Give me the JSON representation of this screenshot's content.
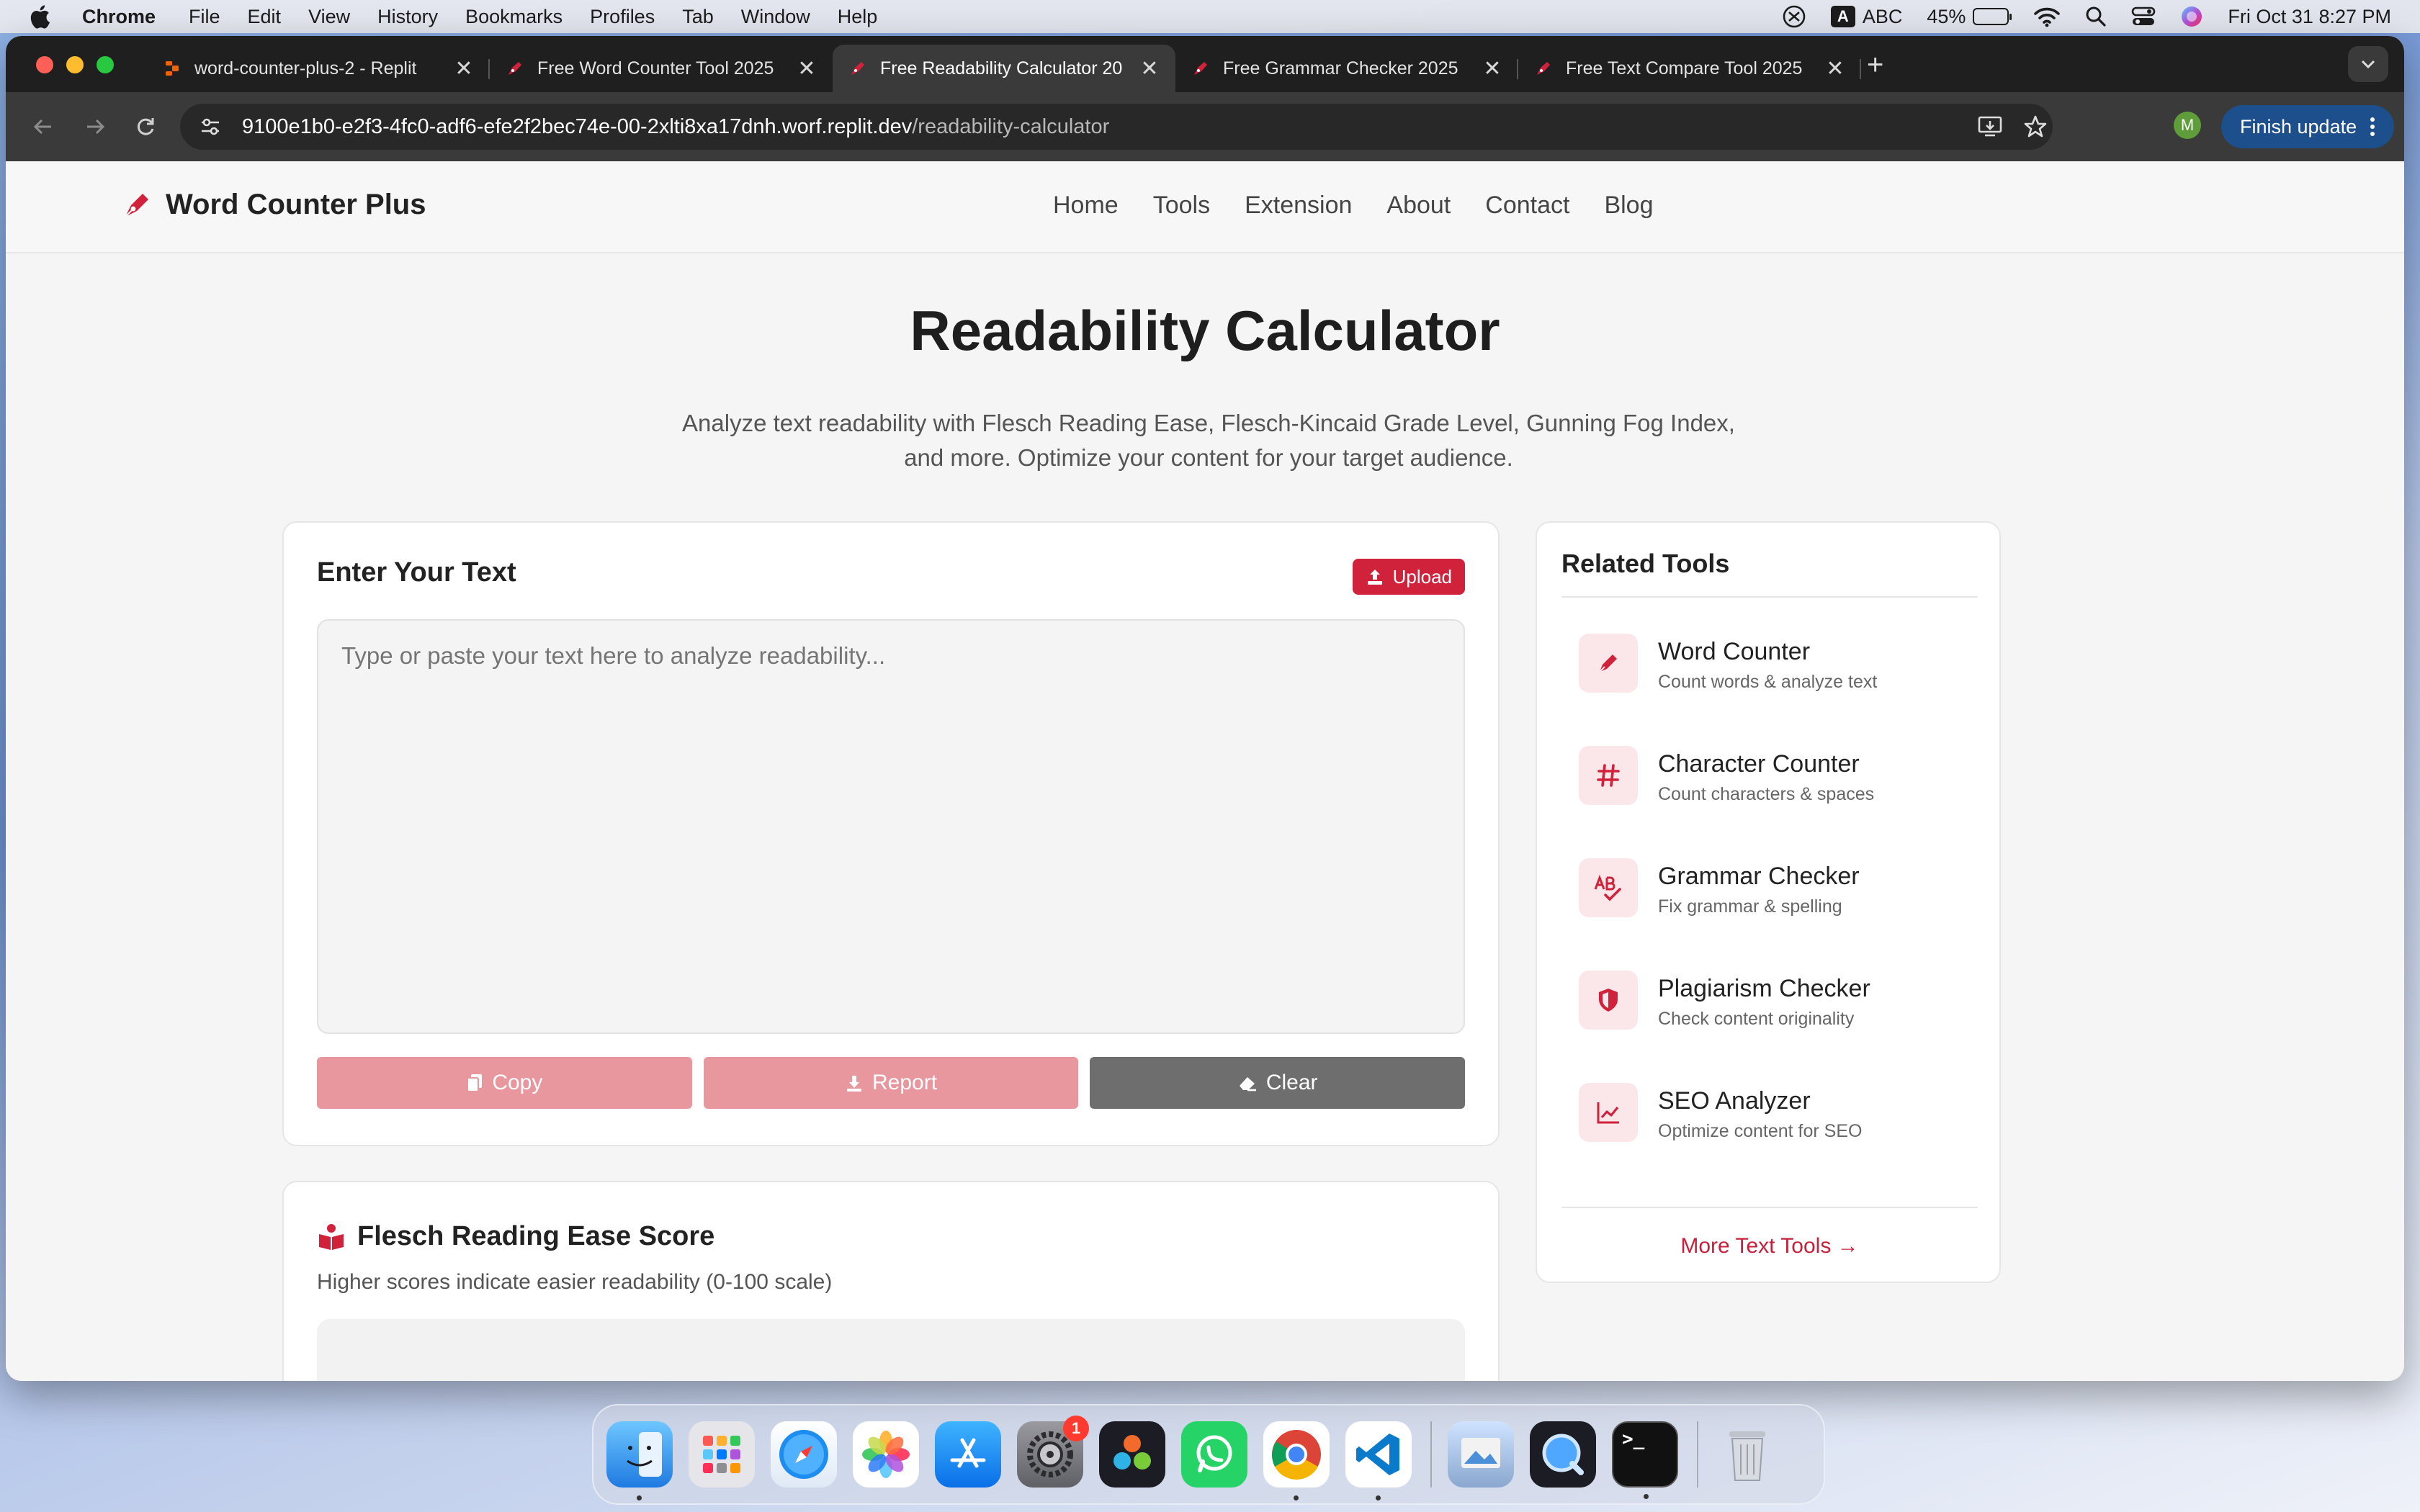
{
  "menubar": {
    "app": "Chrome",
    "items": [
      "File",
      "Edit",
      "View",
      "History",
      "Bookmarks",
      "Profiles",
      "Tab",
      "Window",
      "Help"
    ],
    "input_source": "ABC",
    "input_badge": "A",
    "battery_percent": "45%",
    "battery_level": 0.45,
    "datetime": "Fri Oct 31  8:27 PM"
  },
  "browser": {
    "tabs": [
      {
        "title": "word-counter-plus-2 - Replit",
        "favicon": "replit-icon"
      },
      {
        "title": "Free Word Counter Tool 2025",
        "favicon": "pen-nib-icon"
      },
      {
        "title": "Free Readability Calculator 20",
        "favicon": "pen-nib-icon",
        "active": true
      },
      {
        "title": "Free Grammar Checker 2025",
        "favicon": "pen-nib-icon"
      },
      {
        "title": "Free Text Compare Tool 2025",
        "favicon": "pen-nib-icon"
      }
    ],
    "close_glyph": "✕",
    "new_tab_glyph": "+",
    "url_host": "9100e1b0-e2f3-4fc0-adf6-efe2f2bec74e-00-2xlti8xa17dnh.worf.replit.dev",
    "url_path": "/readability-calculator",
    "profile_initial": "M",
    "finish_update": "Finish update"
  },
  "site": {
    "brand": "Word Counter Plus",
    "nav": [
      "Home",
      "Tools",
      "Extension",
      "About",
      "Contact",
      "Blog"
    ],
    "title": "Readability Calculator",
    "subtitle": "Analyze text readability with Flesch Reading Ease, Flesch-Kincaid Grade Level, Gunning Fog Index, and more. Optimize your content for your target audience."
  },
  "input_card": {
    "title": "Enter Your Text",
    "upload": "Upload",
    "placeholder": "Type or paste your text here to analyze readability...",
    "copy": "Copy",
    "report": "Report",
    "clear": "Clear"
  },
  "score_card": {
    "title": "Flesch Reading Ease Score",
    "subtitle": "Higher scores indicate easier readability (0-100 scale)"
  },
  "related": {
    "title": "Related Tools",
    "items": [
      {
        "title": "Word Counter",
        "desc": "Count words & analyze text",
        "icon": "pen-icon"
      },
      {
        "title": "Character Counter",
        "desc": "Count characters & spaces",
        "icon": "hashtag-icon"
      },
      {
        "title": "Grammar Checker",
        "desc": "Fix grammar & spelling",
        "icon": "spell-check-icon"
      },
      {
        "title": "Plagiarism Checker",
        "desc": "Check content originality",
        "icon": "shield-icon"
      },
      {
        "title": "SEO Analyzer",
        "desc": "Optimize content for SEO",
        "icon": "chart-line-icon"
      }
    ],
    "more": "More Text Tools →"
  },
  "dock": {
    "settings_badge": "1",
    "terminal_glyph": ">_"
  },
  "colors": {
    "brand_red": "#d0233b",
    "button_pink": "#e8979f",
    "button_gray": "#6e6e6e",
    "chrome_dark": "#1f1f1f",
    "update_blue": "#1d4f8c"
  }
}
